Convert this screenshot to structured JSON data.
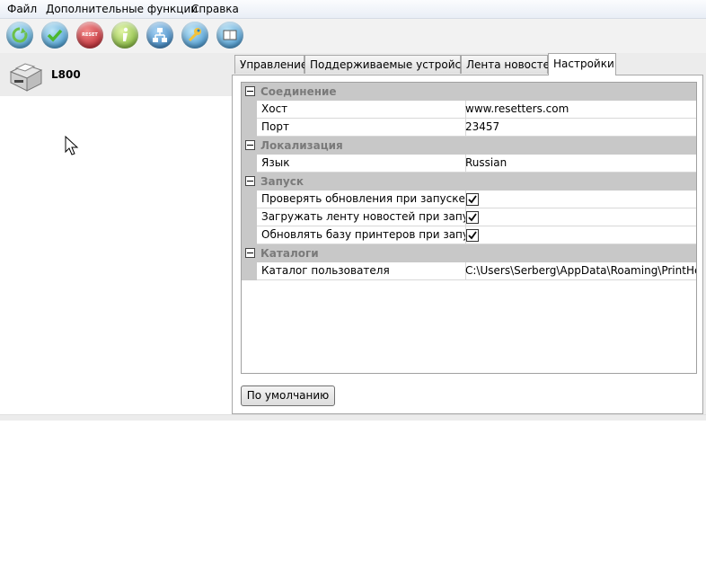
{
  "menu": {
    "items": [
      {
        "label": "Файл"
      },
      {
        "label": "Дополнительные функции"
      },
      {
        "label": "Справка"
      }
    ]
  },
  "toolbar": {
    "buttons": [
      {
        "name": "refresh",
        "icon": "refresh-icon",
        "color": "#4fa8d8"
      },
      {
        "name": "check",
        "icon": "check-icon",
        "color": "#3a9bd0"
      },
      {
        "name": "reset",
        "icon": "reset-icon",
        "label": "RESET",
        "color": "#c8202a"
      },
      {
        "name": "info",
        "icon": "info-icon",
        "color": "#7ab32e"
      },
      {
        "name": "network",
        "icon": "network-icon",
        "color": "#2f7fc0"
      },
      {
        "name": "tools",
        "icon": "wrench-icon",
        "color": "#3a8fd0"
      },
      {
        "name": "book",
        "icon": "book-icon",
        "color": "#3a8fd0"
      }
    ]
  },
  "device": {
    "name": "L800",
    "icon": "printer-icon"
  },
  "tabs": [
    {
      "label": "Управление",
      "active": false
    },
    {
      "label": "Поддерживаемые устройства",
      "active": false
    },
    {
      "label": "Лента новостей",
      "active": false
    },
    {
      "label": "Настройки",
      "active": true
    }
  ],
  "settings": {
    "categories": [
      {
        "label": "Соединение",
        "props": [
          {
            "name": "Хост",
            "value": "www.resetters.com"
          },
          {
            "name": "Порт",
            "value": "23457"
          }
        ]
      },
      {
        "label": "Локализация",
        "props": [
          {
            "name": "Язык",
            "value": "Russian"
          }
        ]
      },
      {
        "label": "Запуск",
        "props": [
          {
            "name": "Проверять обновления при запуске",
            "checked": true
          },
          {
            "name": "Загружать ленту новостей при запуске",
            "checked": true
          },
          {
            "name": "Обновлять базу принтеров при запуске",
            "checked": true
          }
        ]
      },
      {
        "label": "Каталоги",
        "props": [
          {
            "name": "Каталог пользователя",
            "value": "C:\\Users\\Serberg\\AppData\\Roaming\\PrintHelp\\"
          }
        ]
      }
    ],
    "default_button": "По умолчанию"
  }
}
